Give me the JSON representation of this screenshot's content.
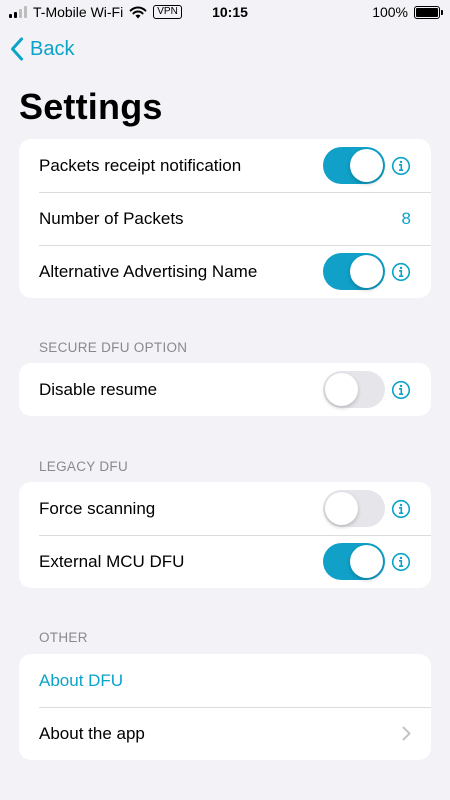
{
  "status_bar": {
    "carrier": "T-Mobile Wi-Fi",
    "vpn": "VPN",
    "time": "10:15",
    "battery": "100%"
  },
  "nav": {
    "back_label": "Back",
    "title": "Settings"
  },
  "groups": {
    "general": {
      "packets_receipt": {
        "label": "Packets receipt notification",
        "on": true
      },
      "number_of_packets": {
        "label": "Number of Packets",
        "value": "8"
      },
      "alt_adv_name": {
        "label": "Alternative Advertising Name",
        "on": true
      }
    },
    "secure_dfu": {
      "header": "SECURE DFU OPTION",
      "disable_resume": {
        "label": "Disable resume",
        "on": false
      }
    },
    "legacy_dfu": {
      "header": "LEGACY DFU",
      "force_scanning": {
        "label": "Force scanning",
        "on": false
      },
      "external_mcu": {
        "label": "External MCU DFU",
        "on": true
      }
    },
    "other": {
      "header": "OTHER",
      "about_dfu": {
        "label": "About DFU"
      },
      "about_app": {
        "label": "About the app"
      }
    }
  },
  "colors": {
    "accent": "#0aa3c9",
    "toggle_on": "#10a0c8",
    "toggle_off": "#e5e5ea",
    "background": "#f2f2f7"
  }
}
